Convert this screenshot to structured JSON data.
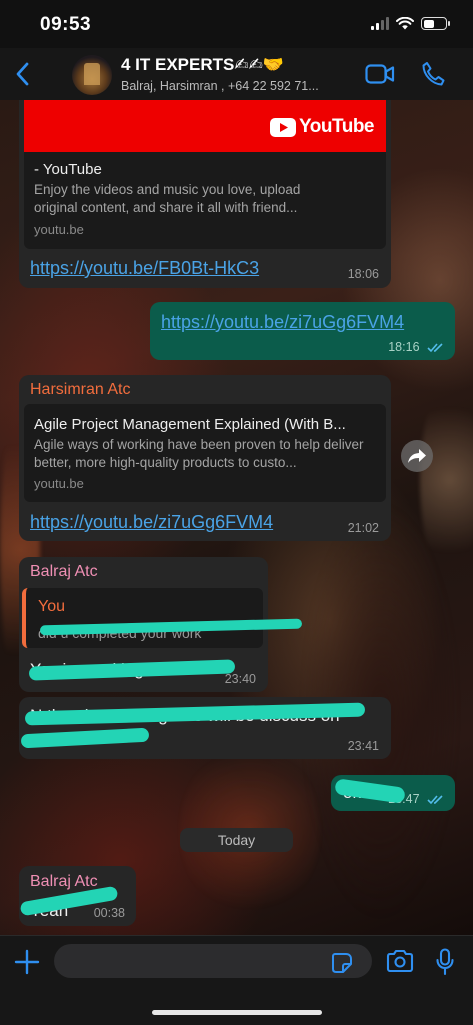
{
  "status_bar": {
    "time": "09:53"
  },
  "header": {
    "title": "4 IT EXPERTS✍✍🤝",
    "subtitle": "Balraj, Harsimran , +64 22 592 71..."
  },
  "messages": {
    "m1": {
      "preview_brand": "YouTube",
      "preview_title": "- YouTube",
      "preview_desc": "Enjoy the videos and music you love, upload original content, and share it all with friend...",
      "preview_host": "youtu.be",
      "link": "https://youtu.be/FB0Bt-HkC3",
      "time": "18:06"
    },
    "m2": {
      "link": "https://youtu.be/zi7uGg6FVM4",
      "time": "18:16"
    },
    "m3": {
      "sender": "Harsimran  Atc",
      "preview_title": "Agile Project Management Explained (With B...",
      "preview_desc": "Agile ways of working have been proven to help deliver better, more high-quality products to custo...",
      "preview_host": "youtu.be",
      "link": "https://youtu.be/zi7uGg6FVM4",
      "time": "21:02"
    },
    "m4": {
      "sender": "Balraj Atc",
      "quote_author": "You",
      "quote_text": "did u completed your work",
      "text": "Yes im working on it",
      "time": "23:40"
    },
    "m5": {
      "text": "N then lot off things we will be discuss on zoom",
      "time": "23:41"
    },
    "m6": {
      "text": "ok",
      "time": "23:47"
    },
    "date_divider": "Today",
    "m7": {
      "sender": "Balraj Atc",
      "text": "Yeah",
      "time": "00:38"
    }
  },
  "colors": {
    "incoming_bubble": "#262626",
    "outgoing_bubble": "#0b5c4b",
    "link": "#4aa3e6",
    "accent_blue": "#2f8ff0",
    "sender_harsimran": "#f26d3d",
    "sender_balraj": "#ef8fb4",
    "redaction": "#23d4b5"
  },
  "icons": [
    "back-chevron-icon",
    "video-call-icon",
    "phone-icon",
    "forward-icon",
    "read-ticks-icon",
    "plus-icon",
    "sticker-icon",
    "camera-icon",
    "microphone-icon"
  ]
}
